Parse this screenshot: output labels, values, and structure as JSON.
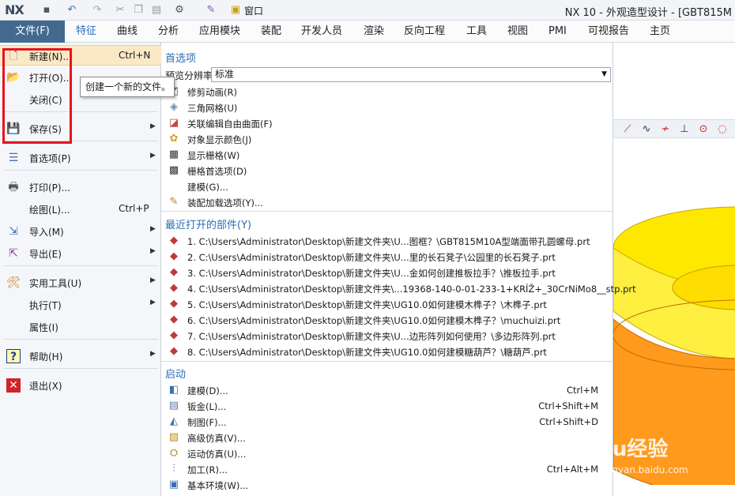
{
  "app": {
    "logo": "NX",
    "title": "NX 10 - 外观造型设计 - [GBT815M",
    "quick_window_label": "窗口"
  },
  "ribbon": {
    "file_label": "文件(F)",
    "tabs": [
      "特征",
      "曲线",
      "分析",
      "应用模块",
      "装配",
      "开发人员",
      "渲染",
      "反向工程",
      "工具",
      "视图",
      "PMI",
      "可视报告",
      "主页"
    ]
  },
  "menu_left": {
    "items": [
      {
        "label": "新建(N)...",
        "shortcut": "Ctrl+N",
        "icon": "new-file-icon"
      },
      {
        "label": "打开(O)...",
        "shortcut": "",
        "icon": "open-folder-icon"
      },
      {
        "label": "关闭(C)",
        "shortcut": "",
        "icon": ""
      },
      {
        "label": "保存(S)",
        "shortcut": "",
        "icon": "save-icon"
      },
      {
        "label": "首选项(P)",
        "shortcut": "",
        "icon": "preferences-icon"
      },
      {
        "label": "打印(P)...",
        "shortcut": "",
        "icon": "printer-icon"
      },
      {
        "label": "绘图(L)...",
        "shortcut": "Ctrl+P",
        "icon": ""
      },
      {
        "label": "导入(M)",
        "shortcut": "",
        "icon": "import-icon"
      },
      {
        "label": "导出(E)",
        "shortcut": "",
        "icon": "export-icon"
      },
      {
        "label": "实用工具(U)",
        "shortcut": "",
        "icon": "tools-icon"
      },
      {
        "label": "执行(T)",
        "shortcut": "",
        "icon": ""
      },
      {
        "label": "属性(I)",
        "shortcut": "",
        "icon": ""
      },
      {
        "label": "帮助(H)",
        "shortcut": "",
        "icon": "help-icon"
      },
      {
        "label": "退出(X)",
        "shortcut": "",
        "icon": "exit-icon"
      }
    ],
    "tooltip": "创建一个新的文件。"
  },
  "preferences": {
    "heading": "首选项",
    "resolution_label": "预览分辨率",
    "resolution_value": "标准",
    "items": [
      {
        "label": "修剪动画(R)",
        "icon": "trim-animation-icon"
      },
      {
        "label": "三角网格(U)",
        "icon": "triangle-mesh-icon"
      },
      {
        "label": "关联编辑自由曲面(F)",
        "icon": "freeform-surface-icon"
      },
      {
        "label": "对象显示颜色(J)",
        "icon": "object-color-icon"
      },
      {
        "label": "显示栅格(W)",
        "icon": "grid-icon"
      },
      {
        "label": "栅格首选项(D)",
        "icon": "grid-pref-icon"
      },
      {
        "label": "建模(G)...",
        "icon": ""
      },
      {
        "label": "装配加载选项(Y)...",
        "icon": "assembly-load-icon"
      }
    ]
  },
  "recent": {
    "heading": "最近打开的部件(Y)",
    "items": [
      "1. C:\\Users\\Administrator\\Desktop\\新建文件夹\\U...图框？\\GBT815M10A型端面带孔圆螺母.prt",
      "2. C:\\Users\\Administrator\\Desktop\\新建文件夹\\U...里的长石凳子\\公园里的长石凳子.prt",
      "3. C:\\Users\\Administrator\\Desktop\\新建文件夹\\U...金如何创建推板拉手？\\推板拉手.prt",
      "4. C:\\Users\\Administrator\\Desktop\\新建文件夹\\...19368-140-0-01-233-1+KRÍŽ+_30CrNiMo8__stp.prt",
      "5. C:\\Users\\Administrator\\Desktop\\新建文件夹\\UG10.0如何建模木榫子？\\木榫子.prt",
      "6. C:\\Users\\Administrator\\Desktop\\新建文件夹\\UG10.0如何建模木榫子？\\muchuizi.prt",
      "7. C:\\Users\\Administrator\\Desktop\\新建文件夹\\U...边形阵列如何使用？\\多边形阵列.prt",
      "8. C:\\Users\\Administrator\\Desktop\\新建文件夹\\UG10.0如何建模糖葫芦？\\糖葫芦.prt"
    ]
  },
  "startup": {
    "heading": "启动",
    "items": [
      {
        "label": "建模(D)...",
        "shortcut": "Ctrl+M",
        "icon": "modeling-icon"
      },
      {
        "label": "钣金(L)...",
        "shortcut": "Ctrl+Shift+M",
        "icon": "sheet-metal-icon"
      },
      {
        "label": "制图(F)...",
        "shortcut": "Ctrl+Shift+D",
        "icon": "drafting-icon"
      },
      {
        "label": "高级仿真(V)...",
        "shortcut": "",
        "icon": "advanced-sim-icon"
      },
      {
        "label": "运动仿真(U)...",
        "shortcut": "",
        "icon": "motion-sim-icon"
      },
      {
        "label": "加工(R)...",
        "shortcut": "Ctrl+Alt+M",
        "icon": "manufacturing-icon"
      },
      {
        "label": "基本环境(W)...",
        "shortcut": "",
        "icon": "gateway-icon"
      }
    ]
  },
  "watermark": {
    "text": "Baidu经验",
    "url": "jingyan.baidu.com"
  }
}
